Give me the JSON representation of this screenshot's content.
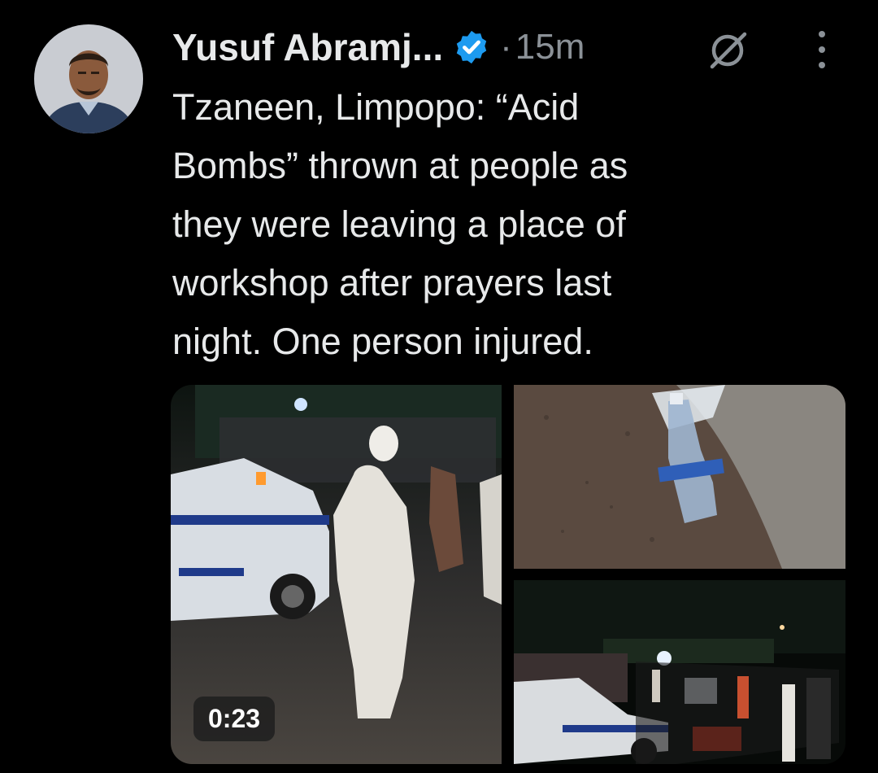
{
  "author": {
    "display_name": "Yusuf Abramj...",
    "verified": true,
    "avatar_icon": "profile-avatar"
  },
  "meta": {
    "separator": "·",
    "timestamp": "15m"
  },
  "icons": {
    "grok": "grok-icon",
    "more": "more-options-icon",
    "verified": "verified-badge-icon"
  },
  "tweet": {
    "text": "Tzaneen, Limpopo: “Acid\nBombs” thrown at people as\nthey were leaving a place of\nworkshop after prayers last\nnight. One person injured."
  },
  "media": {
    "video_duration": "0:23",
    "items": [
      "video-crowd-police-car",
      "photo-plastic-bottle-on-ground",
      "photo-night-street-crowd"
    ]
  },
  "colors": {
    "background": "#000000",
    "text": "#e7e9ea",
    "muted": "#8b9197",
    "verified_blue": "#1d9bf0"
  }
}
